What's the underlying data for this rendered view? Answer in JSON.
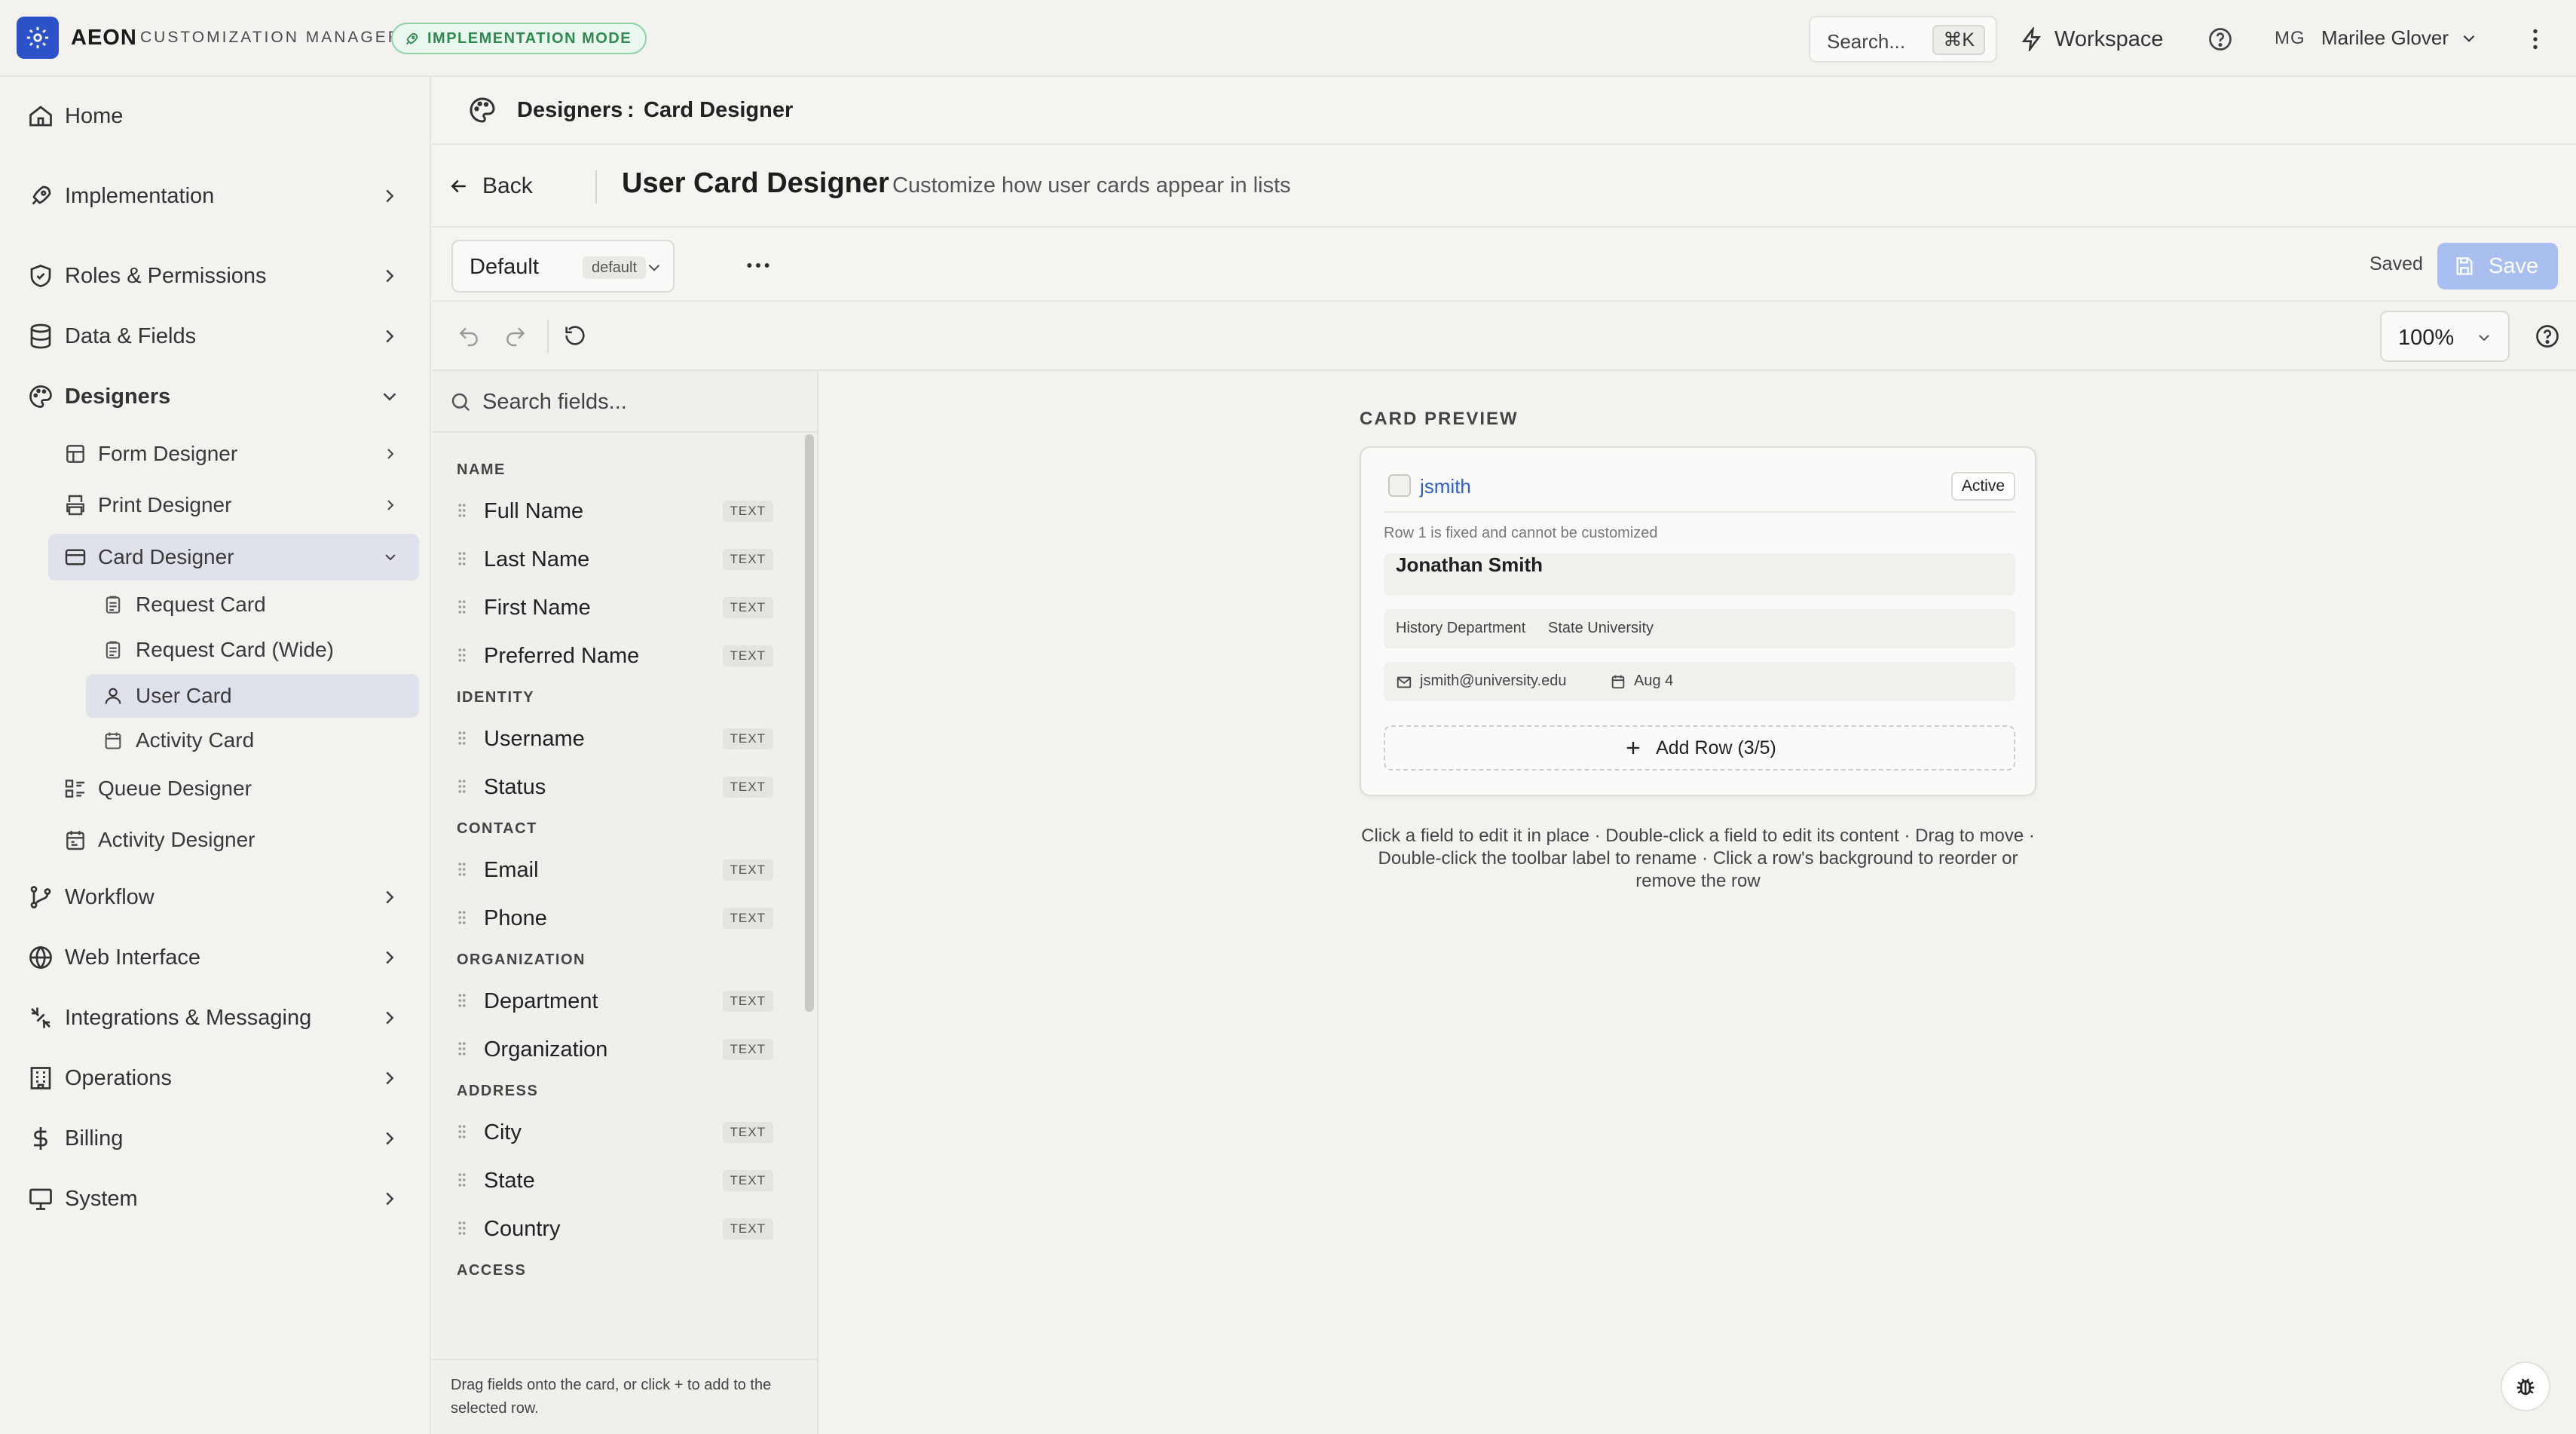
{
  "topbar": {
    "app_name": "AEON",
    "app_subtitle": "CUSTOMIZATION MANAGER",
    "mode_badge": "IMPLEMENTATION MODE",
    "search_label": "Search...",
    "search_shortcut": "⌘K",
    "workspace_label": "Workspace",
    "user_initials": "MG",
    "user_name": "Marilee Glover"
  },
  "sidebar": {
    "home": "Home",
    "implementation": "Implementation",
    "roles": "Roles & Permissions",
    "data_fields": "Data & Fields",
    "designers": "Designers",
    "form_designer": "Form Designer",
    "print_designer": "Print Designer",
    "card_designer": "Card Designer",
    "request_card": "Request Card",
    "request_card_wide": "Request Card (Wide)",
    "user_card": "User Card",
    "activity_card": "Activity Card",
    "queue_designer": "Queue Designer",
    "activity_designer": "Activity Designer",
    "workflow": "Workflow",
    "web_interface": "Web Interface",
    "integrations": "Integrations & Messaging",
    "operations": "Operations",
    "billing": "Billing",
    "system": "System"
  },
  "breadcrumb": {
    "parent": "Designers",
    "separator": ":",
    "current": "Card Designer"
  },
  "header": {
    "back_label": "Back",
    "title": "User Card Designer",
    "subtitle": "Customize how user cards appear in lists"
  },
  "toolbar": {
    "variant_name": "Default",
    "variant_tag": "default",
    "saved_status": "Saved",
    "save_label": "Save",
    "zoom_level": "100%"
  },
  "fields_panel": {
    "search_placeholder": "Search fields...",
    "groups": [
      {
        "title": "NAME",
        "fields": [
          {
            "name": "Full Name",
            "type": "TEXT"
          },
          {
            "name": "Last Name",
            "type": "TEXT"
          },
          {
            "name": "First Name",
            "type": "TEXT"
          },
          {
            "name": "Preferred Name",
            "type": "TEXT"
          }
        ]
      },
      {
        "title": "IDENTITY",
        "fields": [
          {
            "name": "Username",
            "type": "TEXT"
          },
          {
            "name": "Status",
            "type": "TEXT"
          }
        ]
      },
      {
        "title": "CONTACT",
        "fields": [
          {
            "name": "Email",
            "type": "TEXT"
          },
          {
            "name": "Phone",
            "type": "TEXT"
          }
        ]
      },
      {
        "title": "ORGANIZATION",
        "fields": [
          {
            "name": "Department",
            "type": "TEXT"
          },
          {
            "name": "Organization",
            "type": "TEXT"
          }
        ]
      },
      {
        "title": "ADDRESS",
        "fields": [
          {
            "name": "City",
            "type": "TEXT"
          },
          {
            "name": "State",
            "type": "TEXT"
          },
          {
            "name": "Country",
            "type": "TEXT"
          }
        ]
      },
      {
        "title": "ACCESS",
        "fields": []
      }
    ],
    "footer_hint": "Drag fields onto the card, or click + to add to the selected row."
  },
  "preview": {
    "label": "CARD PREVIEW",
    "username": "jsmith",
    "status": "Active",
    "fixed_note": "Row 1 is fixed and cannot be customized",
    "full_name": "Jonathan Smith",
    "department": "History Department",
    "organization": "State University",
    "email": "jsmith@university.edu",
    "date": "Aug 4",
    "add_row_label": "Add Row (3/5)",
    "help_text": "Click a field to edit it in place · Double-click a field to edit its content · Drag to move · Double-click the toolbar label to rename · Click a row's background to reorder or remove the row"
  },
  "colors": {
    "accent": "#2c52c9",
    "save_button": "#a9bff0",
    "badge_green": "#2f8a50",
    "link": "#2f5fc7"
  },
  "icons": [
    "gear-icon",
    "rocket-icon",
    "shield-icon",
    "database-icon",
    "palette-icon",
    "layout-icon",
    "printer-icon",
    "card-icon",
    "clipboard-icon",
    "user-icon",
    "queue-icon",
    "calendar-icon",
    "workflow-icon",
    "globe-icon",
    "plug-icon",
    "building-icon",
    "dollar-icon",
    "monitor-icon",
    "chevron-right-icon",
    "chevron-down-icon",
    "lightning-icon",
    "help-icon",
    "kebab-icon",
    "arrow-left-icon",
    "undo-icon",
    "redo-icon",
    "reset-icon",
    "search-icon",
    "grip-icon",
    "save-icon",
    "mail-icon",
    "plus-icon",
    "bug-icon"
  ]
}
